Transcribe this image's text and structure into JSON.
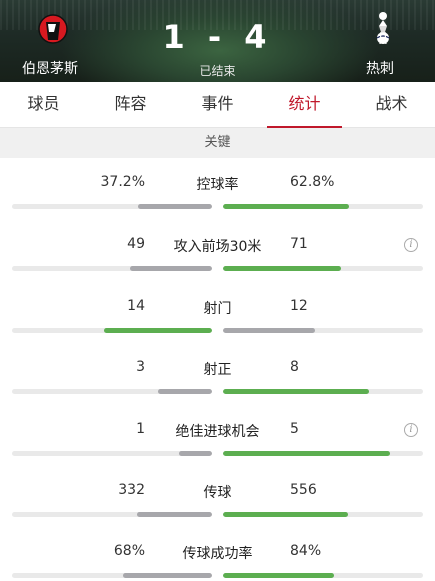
{
  "match": {
    "home_team": "伯恩茅斯",
    "away_team": "热刺",
    "home_score": "1",
    "away_score": "4",
    "separator": "-",
    "status": "已结束"
  },
  "tabs": [
    {
      "label": "球员",
      "active": false
    },
    {
      "label": "阵容",
      "active": false
    },
    {
      "label": "事件",
      "active": false
    },
    {
      "label": "统计",
      "active": true
    },
    {
      "label": "战术",
      "active": false
    }
  ],
  "section": {
    "title": "关键"
  },
  "stats": [
    {
      "name": "控球率",
      "home": "37.2%",
      "away": "62.8%",
      "home_value": 37.2,
      "away_value": 62.8,
      "home_color": "grey",
      "away_color": "green",
      "info": false
    },
    {
      "name": "攻入前场30米",
      "home": "49",
      "away": "71",
      "home_value": 49,
      "away_value": 71,
      "home_color": "grey",
      "away_color": "green",
      "info": true
    },
    {
      "name": "射门",
      "home": "14",
      "away": "12",
      "home_value": 14,
      "away_value": 12,
      "home_color": "green",
      "away_color": "grey",
      "info": false
    },
    {
      "name": "射正",
      "home": "3",
      "away": "8",
      "home_value": 3,
      "away_value": 8,
      "home_color": "grey",
      "away_color": "green",
      "info": false
    },
    {
      "name": "绝佳进球机会",
      "home": "1",
      "away": "5",
      "home_value": 1,
      "away_value": 5,
      "home_color": "grey",
      "away_color": "green",
      "info": true
    },
    {
      "name": "传球",
      "home": "332",
      "away": "556",
      "home_value": 332,
      "away_value": 556,
      "home_color": "grey",
      "away_color": "green",
      "info": false
    },
    {
      "name": "传球成功率",
      "home": "68%",
      "away": "84%",
      "home_value": 68,
      "away_value": 84,
      "home_color": "grey",
      "away_color": "green",
      "info": false
    }
  ],
  "info_icon": "i",
  "colors": {
    "accent": "#c0182b",
    "green": "#5cae50",
    "grey": "#a7a7ab",
    "track": "#e9e9e9"
  },
  "icons": {
    "home_crest": "bournemouth-crest-icon",
    "away_crest": "tottenham-crest-icon",
    "info": "info-icon"
  }
}
